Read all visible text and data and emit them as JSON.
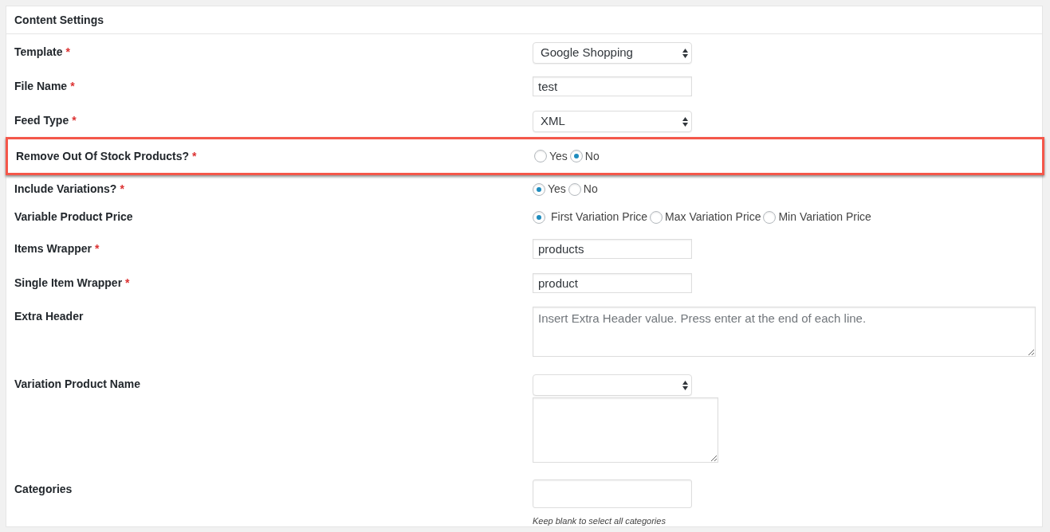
{
  "panel": {
    "title": "Content Settings"
  },
  "rows": [
    {
      "kind": "select",
      "label": "Template",
      "required_mark": "*",
      "highlighted": false,
      "value": "Google Shopping"
    },
    {
      "kind": "text",
      "label": "File Name",
      "required_mark": "*",
      "highlighted": false,
      "value": "test"
    },
    {
      "kind": "select",
      "label": "Feed Type",
      "required_mark": "*",
      "highlighted": false,
      "value": "XML"
    },
    {
      "kind": "radio",
      "label": "Remove Out Of Stock Products?",
      "required_mark": "*",
      "highlighted": true,
      "options": [
        {
          "label": "Yes",
          "selected": false
        },
        {
          "label": "No",
          "selected": true
        }
      ]
    },
    {
      "kind": "radio",
      "label": "Include Variations?",
      "required_mark": "*",
      "highlighted": false,
      "options": [
        {
          "label": "Yes",
          "selected": true
        },
        {
          "label": "No",
          "selected": false
        }
      ]
    },
    {
      "kind": "radio",
      "label": "Variable Product Price",
      "highlighted": false,
      "options": [
        {
          "label": "First Variation Price",
          "selected": true
        },
        {
          "label": "Max Variation Price",
          "selected": false
        },
        {
          "label": "Min Variation Price",
          "selected": false
        }
      ]
    },
    {
      "kind": "text",
      "label": "Items Wrapper",
      "required_mark": "*",
      "highlighted": false,
      "value": "products"
    },
    {
      "kind": "text",
      "label": "Single Item Wrapper",
      "required_mark": "*",
      "highlighted": false,
      "value": "product"
    },
    {
      "kind": "textarea",
      "label": "Extra Header",
      "highlighted": false,
      "placeholder": "Insert Extra Header value. Press enter at the end of each line."
    },
    {
      "kind": "select_textarea",
      "label": "Variation Product Name",
      "highlighted": false
    },
    {
      "kind": "categories",
      "label": "Categories",
      "highlighted": false,
      "hint": "Keep blank to select all categories"
    }
  ]
}
